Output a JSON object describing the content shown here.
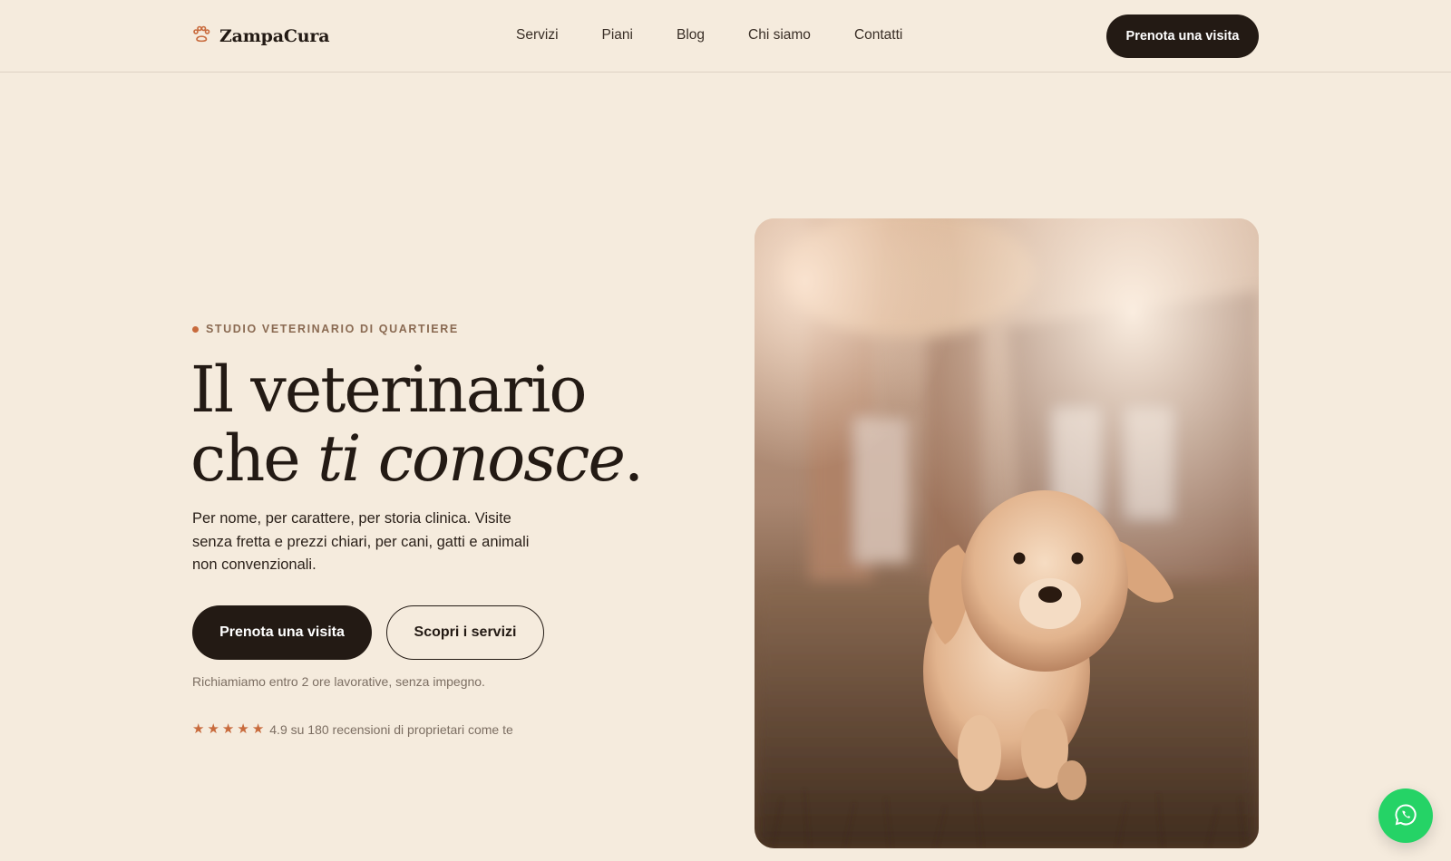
{
  "brand": {
    "name": "ZampaCura",
    "icon": "paw-icon"
  },
  "nav": {
    "links": [
      "Servizi",
      "Piani",
      "Blog",
      "Chi siamo",
      "Contatti"
    ],
    "cta_label": "Prenota una visita"
  },
  "hero": {
    "eyebrow": "STUDIO VETERINARIO DI QUARTIERE",
    "headline_line1": "Il veterinario",
    "headline_line2_prefix": "che ",
    "headline_line2_emphasis": "ti conosce",
    "headline_line2_suffix": ".",
    "lead": "Per nome, per carattere, per storia clinica. Visite senza fretta e prezzi chiari, per cani, gatti e animali non convenzionali.",
    "primary_cta": "Prenota una visita",
    "secondary_cta": "Scopri i servizi",
    "note": "Richiamiamo entro 2 ore lavorative, senza impegno.",
    "rating": {
      "stars": 5,
      "text": "4.9 su 180 recensioni di proprietari come te"
    },
    "image": "puppy-running-photo"
  },
  "floating": {
    "icon": "whatsapp-icon"
  },
  "colors": {
    "background": "#f5ebdd",
    "ink": "#231a14",
    "accent": "#c86a3c",
    "whatsapp": "#25d366"
  }
}
